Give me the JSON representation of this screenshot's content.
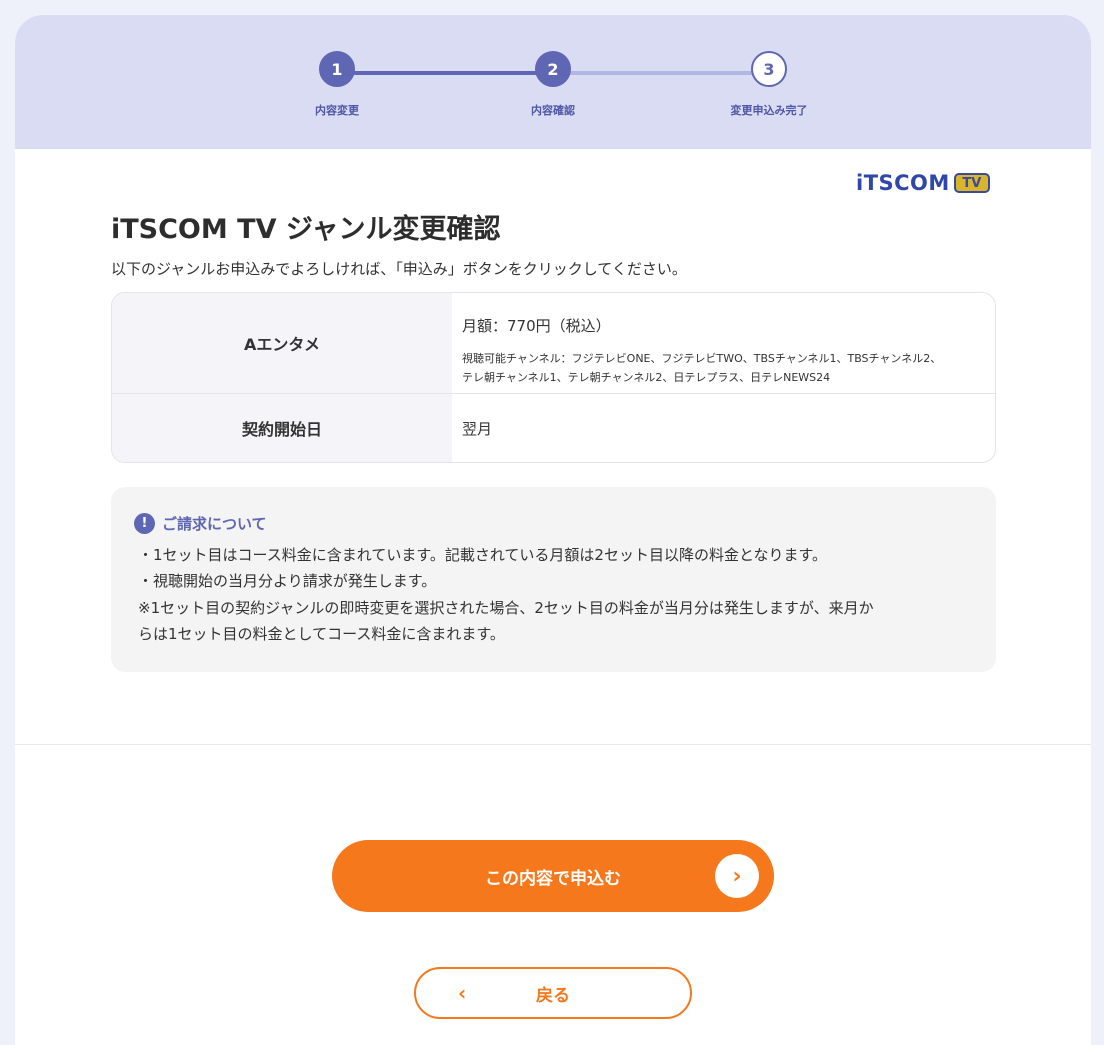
{
  "stepper": {
    "steps": [
      {
        "number": "1",
        "label": "内容変更",
        "state": "done"
      },
      {
        "number": "2",
        "label": "内容確認",
        "state": "current"
      },
      {
        "number": "3",
        "label": "変更申込み完了",
        "state": "pending"
      }
    ]
  },
  "brand": {
    "logo_text": "iTSCOM",
    "logo_badge": "TV"
  },
  "header": {
    "title": "iTSCOM TV ジャンル変更確認",
    "lead": "以下のジャンルお申込みでよろしければ、「申込み」ボタンをクリックしてください。"
  },
  "summary": {
    "genre_label": "Aエンタメ",
    "price": "月額：770円（税込）",
    "channels_line1": "視聴可能チャンネル：フジテレビONE、フジテレビTWO、TBSチャンネル1、TBSチャンネル2、",
    "channels_line2": "テレ朝チャンネル1、テレ朝チャンネル2、日テレプラス、日テレNEWS24",
    "start_label": "契約開始日",
    "start_value": "翌月"
  },
  "notice": {
    "icon": "!",
    "title": "ご請求について",
    "line1": "・1セット目はコース料金に含まれています。記載されている月額は2セット目以降の料金となります。",
    "line2": "・視聴開始の当月分より請求が発生します。",
    "line3": "※1セット目の契約ジャンルの即時変更を選択された場合、2セット目の料金が当月分は発生しますが、来月か",
    "line4": "らは1セット目の料金としてコース料金に含まれます。"
  },
  "actions": {
    "submit_label": "この内容で申込む",
    "submit_arrow": "›",
    "back_label": "戻る",
    "back_arrow": "‹"
  },
  "colors": {
    "accent": "#5f66b3",
    "cta": "#f6781c",
    "stepper_bg": "#d9dcf3"
  }
}
